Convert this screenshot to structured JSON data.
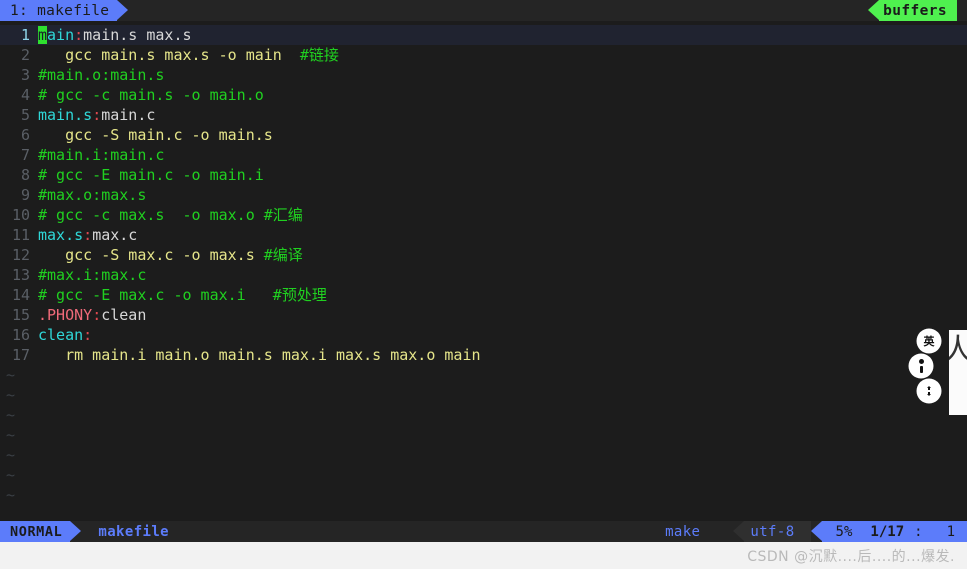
{
  "tabline": {
    "tab_label": "1: makefile",
    "buffers_label": "buffers"
  },
  "editor": {
    "filename": "makefile",
    "cursor_char": "m",
    "lines": [
      {
        "n": "1",
        "current": true,
        "segments": [
          {
            "text": "m",
            "cls": "cursor"
          },
          {
            "text": "ain",
            "cls": "t"
          },
          {
            "text": ":",
            "cls": "col"
          },
          {
            "text": "main.s max.s",
            "cls": "dep"
          }
        ]
      },
      {
        "n": "2",
        "current": false,
        "segments": [
          {
            "text": "   gcc main.s max.s -o main  ",
            "cls": "cmd"
          },
          {
            "text": "#链接",
            "cls": "cmt"
          }
        ]
      },
      {
        "n": "3",
        "current": false,
        "segments": [
          {
            "text": "#main.o:main.s",
            "cls": "cmt"
          }
        ]
      },
      {
        "n": "4",
        "current": false,
        "segments": [
          {
            "text": "# gcc -c main.s -o main.o",
            "cls": "cmt"
          }
        ]
      },
      {
        "n": "5",
        "current": false,
        "segments": [
          {
            "text": "main.s",
            "cls": "t"
          },
          {
            "text": ":",
            "cls": "col"
          },
          {
            "text": "main.c",
            "cls": "dep"
          }
        ]
      },
      {
        "n": "6",
        "current": false,
        "segments": [
          {
            "text": "   gcc -S main.c -o main.s",
            "cls": "cmd"
          }
        ]
      },
      {
        "n": "7",
        "current": false,
        "segments": [
          {
            "text": "#main.i:main.c",
            "cls": "cmt"
          }
        ]
      },
      {
        "n": "8",
        "current": false,
        "segments": [
          {
            "text": "# gcc -E main.c -o main.i",
            "cls": "cmt"
          }
        ]
      },
      {
        "n": "9",
        "current": false,
        "segments": [
          {
            "text": "#max.o:max.s",
            "cls": "cmt"
          }
        ]
      },
      {
        "n": "10",
        "current": false,
        "segments": [
          {
            "text": "# gcc -c max.s  -o max.o #汇编",
            "cls": "cmt"
          }
        ]
      },
      {
        "n": "11",
        "current": false,
        "segments": [
          {
            "text": "max.s",
            "cls": "t"
          },
          {
            "text": ":",
            "cls": "col"
          },
          {
            "text": "max.c",
            "cls": "dep"
          }
        ]
      },
      {
        "n": "12",
        "current": false,
        "segments": [
          {
            "text": "   gcc -S max.c -o max.s ",
            "cls": "cmd"
          },
          {
            "text": "#编译",
            "cls": "cmt"
          }
        ]
      },
      {
        "n": "13",
        "current": false,
        "segments": [
          {
            "text": "#max.i:max.c",
            "cls": "cmt"
          }
        ]
      },
      {
        "n": "14",
        "current": false,
        "segments": [
          {
            "text": "# gcc -E max.c -o max.i   #预处理",
            "cls": "cmt"
          }
        ]
      },
      {
        "n": "15",
        "current": false,
        "segments": [
          {
            "text": ".PHONY",
            "cls": "phony"
          },
          {
            "text": ":",
            "cls": "col"
          },
          {
            "text": "clean",
            "cls": "plain"
          }
        ]
      },
      {
        "n": "16",
        "current": false,
        "segments": [
          {
            "text": "clean",
            "cls": "t"
          },
          {
            "text": ":",
            "cls": "col"
          }
        ]
      },
      {
        "n": "17",
        "current": false,
        "segments": [
          {
            "text": "   rm main.i main.o main.s max.i max.s max.o main",
            "cls": "cmd"
          }
        ]
      }
    ],
    "empty_marker": "~",
    "empty_count": 7
  },
  "statusline": {
    "mode": "NORMAL",
    "filename": "makefile",
    "filetype": "make",
    "encoding": "utf-8",
    "scroll_percent": "5%",
    "line_position": "1/17",
    "separator": ":",
    "column": "1"
  },
  "ime_widget": {
    "lang_label": "英",
    "panel_button": "⬤",
    "extra_button": "✥"
  },
  "watermark": {
    "text": "CSDN @沉默....后....的...爆发."
  },
  "colors": {
    "accent_blue": "#5c7cfa",
    "buffers_green": "#4ff04f",
    "cursor_green": "#2fe02f",
    "target_cyan": "#2fd8d8",
    "comment_green": "#20d020",
    "recipe_yellow": "#e5e58a",
    "phony_red": "#f06a7a",
    "background": "#1c1c1c"
  }
}
